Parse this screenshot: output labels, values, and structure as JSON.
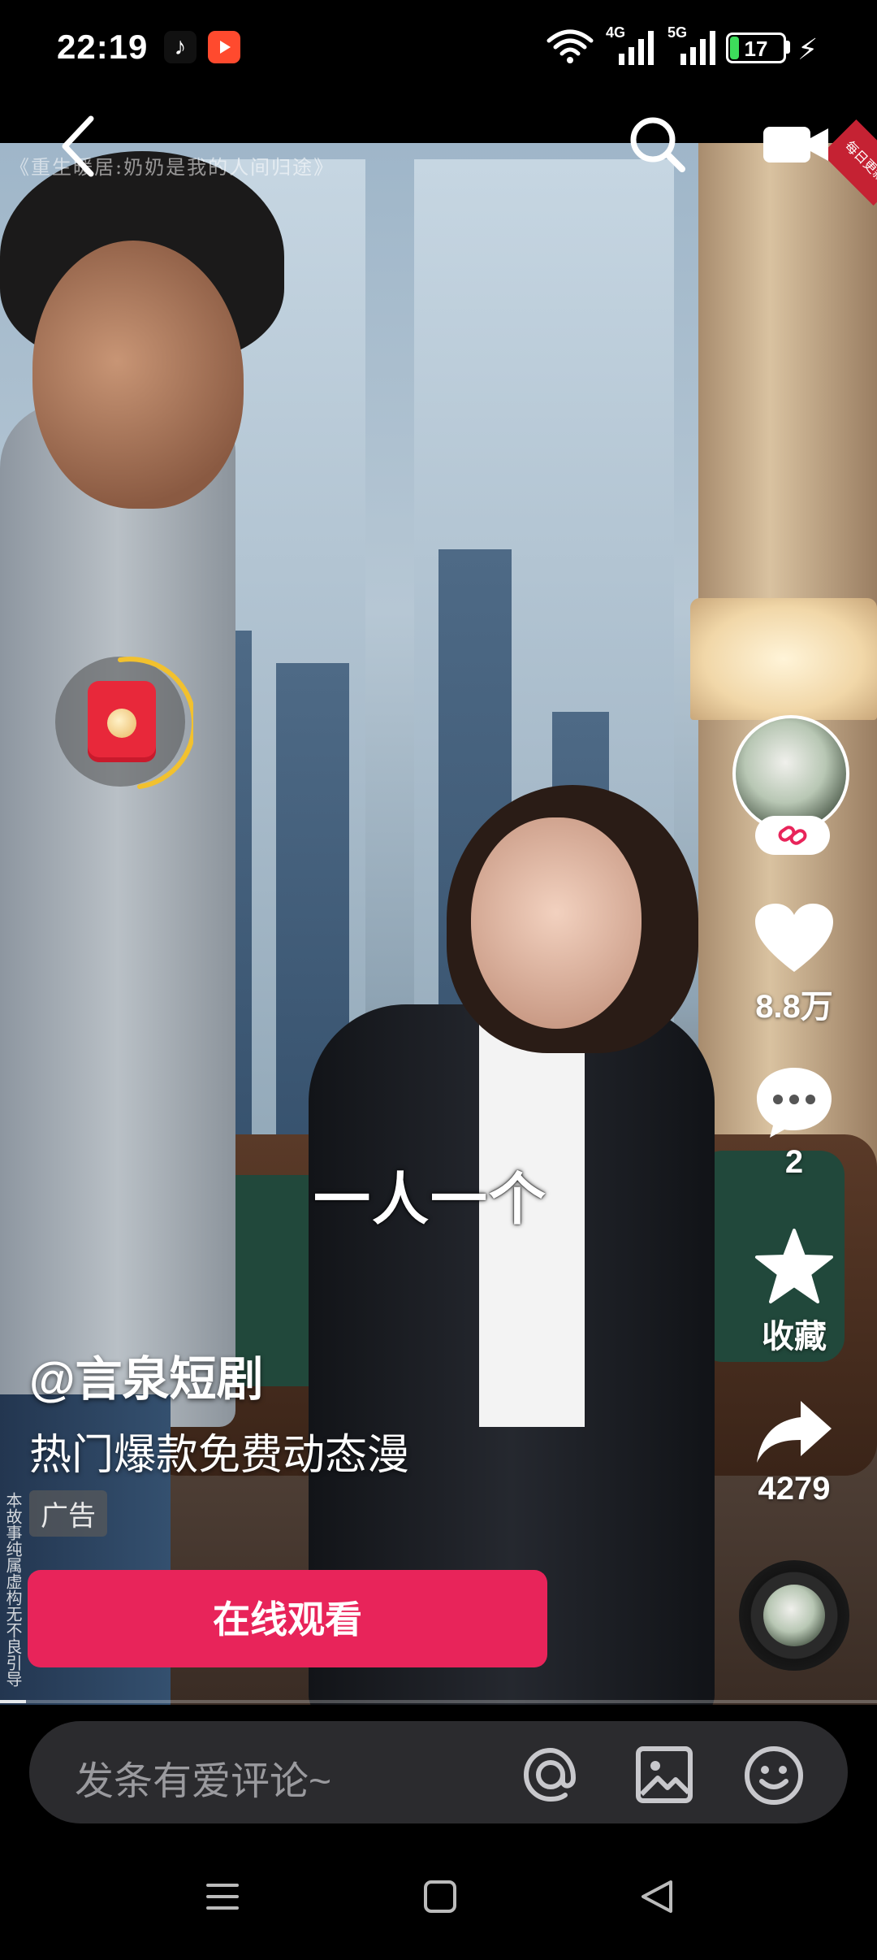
{
  "status_bar": {
    "time": "22:19",
    "network_4g": "4G",
    "network_5g": "5G",
    "battery": "17",
    "battery_level": 0.17,
    "icons": [
      "tiktok-icon",
      "video-app-icon",
      "wifi-icon",
      "signal-icon",
      "battery-icon",
      "charging-icon"
    ]
  },
  "video": {
    "watermark_title": "《重生暖居:奶奶是我的人间归途》",
    "corner_badge": "每日更新",
    "subtitle": "一人一个",
    "progress": 0.03
  },
  "top_bar": {
    "icons": [
      "back-icon",
      "search-icon",
      "camera-icon"
    ]
  },
  "right_rail": {
    "likes": "8.8万",
    "comments": "2",
    "collect_label": "收藏",
    "shares": "4279",
    "icons": [
      "heart-icon",
      "comment-icon",
      "star-icon",
      "share-icon",
      "link-icon"
    ]
  },
  "info": {
    "author": "@言泉短剧",
    "description": "热门爆款免费动态漫",
    "ad_tag": "广告",
    "disclaimer": "本故事纯属虚构无不良引导",
    "watch_button": "在线观看"
  },
  "comment_bar": {
    "placeholder": "发条有爱评论~",
    "icons": [
      "at-icon",
      "image-icon",
      "emoji-icon"
    ]
  },
  "nav_bar": {
    "icons": [
      "menu-icon",
      "home-icon",
      "back-triangle-icon"
    ]
  },
  "colors": {
    "accent": "#e8245a",
    "battery": "#3ddc5b",
    "packet": "#e8283a",
    "ring": "#f2c12e"
  }
}
